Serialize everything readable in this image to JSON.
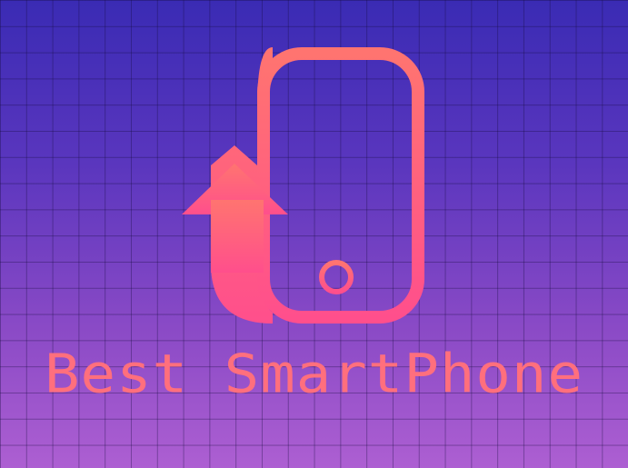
{
  "brand": {
    "name": "Best SmartPhone",
    "icon": "phone-upgrade-arrow-icon"
  },
  "colors": {
    "background_top": "#3a2bb4",
    "background_bottom": "#ad5fd2",
    "grid_line": "#140a3c",
    "logo_gradient_top": "#ff7470",
    "logo_gradient_bottom": "#ff4f8c",
    "text": "#ff6f7d"
  }
}
